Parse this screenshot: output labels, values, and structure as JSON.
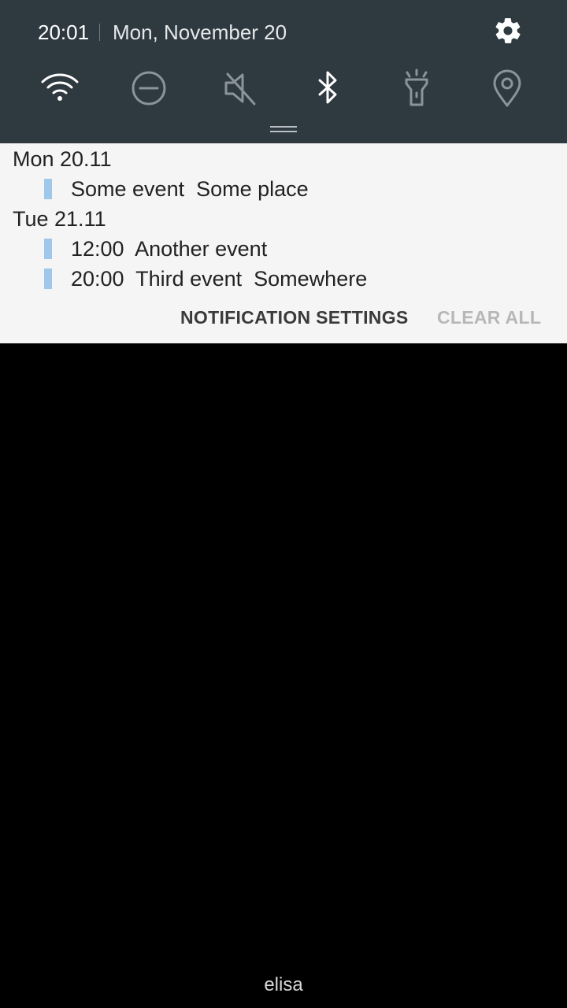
{
  "status": {
    "time": "20:01",
    "date": "Mon, November 20"
  },
  "quick_settings": {
    "tiles": [
      {
        "icon": "wifi-icon",
        "active": true
      },
      {
        "icon": "do-not-disturb-icon",
        "active": false
      },
      {
        "icon": "sound-muted-icon",
        "active": false
      },
      {
        "icon": "bluetooth-icon",
        "active": true
      },
      {
        "icon": "flashlight-icon",
        "active": false
      },
      {
        "icon": "location-icon",
        "active": false
      }
    ],
    "settings_icon": "gear-icon"
  },
  "notification": {
    "days": [
      {
        "header": "Mon 20.11",
        "events": [
          {
            "text": "Some event  Some place",
            "color": "#9ec7ea"
          }
        ]
      },
      {
        "header": "Tue 21.11",
        "events": [
          {
            "text": "12:00  Another event",
            "color": "#9ec7ea"
          },
          {
            "text": "20:00  Third event  Somewhere",
            "color": "#9ec7ea"
          }
        ]
      }
    ],
    "actions": {
      "settings_label": "NOTIFICATION SETTINGS",
      "clear_label": "CLEAR ALL"
    }
  },
  "carrier": "elisa",
  "colors": {
    "panel_bg": "#2f3940",
    "card_bg": "#f5f5f5",
    "active_icon": "#ffffff",
    "inactive_icon": "#8a949a"
  }
}
